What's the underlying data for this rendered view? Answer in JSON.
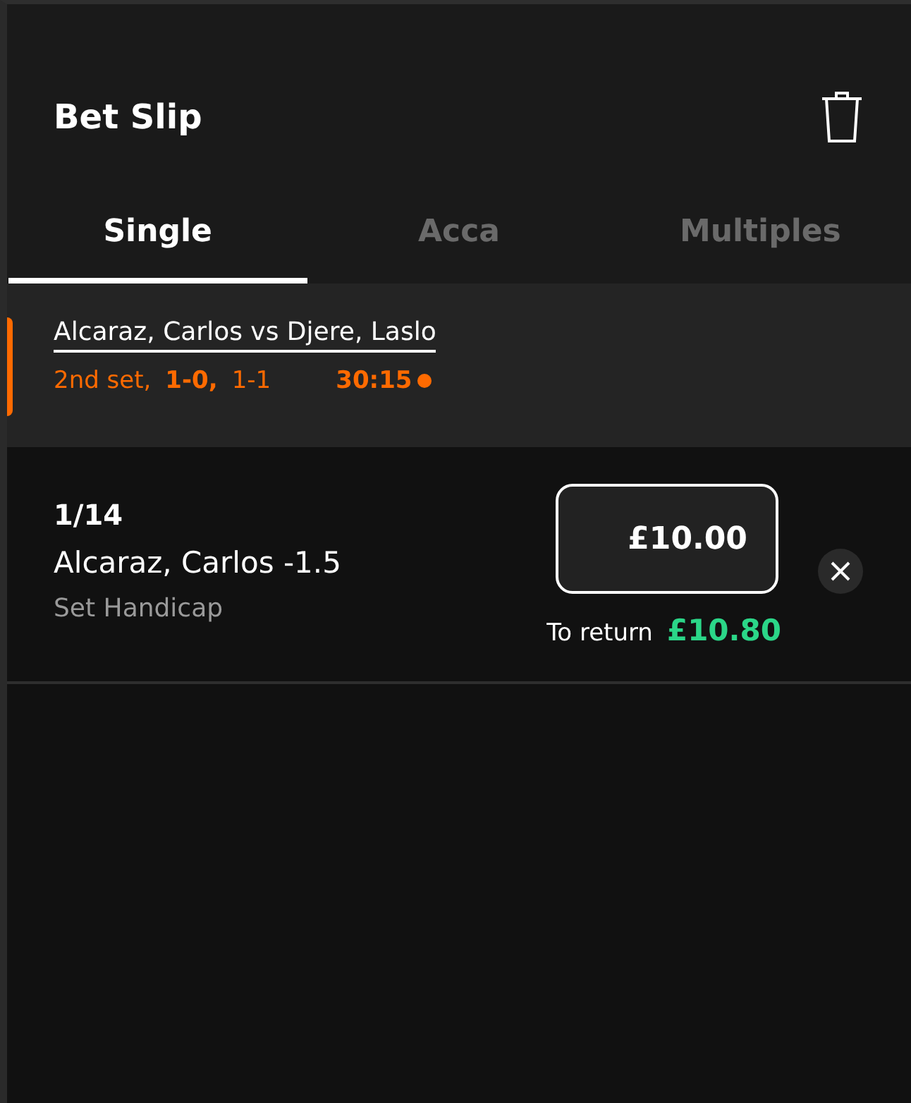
{
  "header": {
    "title": "Bet Slip"
  },
  "tabs": [
    {
      "label": "Single",
      "selected": true
    },
    {
      "label": "Acca",
      "selected": false
    },
    {
      "label": "Multiples",
      "selected": false
    }
  ],
  "event": {
    "title": "Alcaraz, Carlos vs Djere, Laslo",
    "score": [
      {
        "text": "2nd set,",
        "bold": false
      },
      {
        "text": "1-0,",
        "bold": true
      },
      {
        "text": "1-1",
        "bold": false
      }
    ],
    "game_score": "30:15",
    "live": true
  },
  "bet": {
    "odds": "1/14",
    "selection": "Alcaraz, Carlos -1.5",
    "market": "Set Handicap",
    "stake": "£10.00",
    "return_label": "To return",
    "return_value": "£10.80"
  }
}
